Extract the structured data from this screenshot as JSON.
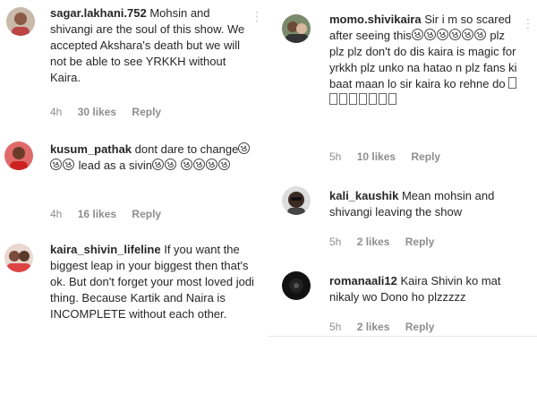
{
  "left_comments": [
    {
      "username": "sagar.lakhani.752",
      "text": "Mohsin and shivangi are the soul of this show. We accepted Akshara's death but we will not be able to see YRKKH without Kaira.",
      "time": "4h",
      "likes": "30 likes",
      "reply": "Reply"
    },
    {
      "username": "kusum_pathak",
      "text_a": "dont dare to change",
      "text_b": "lead as a sivin",
      "time": "4h",
      "likes": "16 likes",
      "reply": "Reply"
    },
    {
      "username": "kaira_shivin_lifeline",
      "text": "If you want the biggest leap in your biggest then that's ok. But don't forget your most loved jodi thing. Because Kartik and Naira is INCOMPLETE without each other."
    }
  ],
  "right_comments": [
    {
      "username": "momo.shivikaira",
      "text_a": "Sir i m so scared after seeing this",
      "text_b": "plz plz plz don't do dis kaira is magic for yrkkh plz unko na hatao n plz fans ki baat maan lo sir kaira ko rehne do",
      "time": "5h",
      "likes": "10 likes",
      "reply": "Reply"
    },
    {
      "username": "kali_kaushik",
      "text": "Mean mohsin and shivangi leaving the show",
      "time": "5h",
      "likes": "2 likes",
      "reply": "Reply"
    },
    {
      "username": "romanaali12",
      "text": "Kaira Shivin ko mat nikaly wo Dono ho plzzzzz",
      "time": "5h",
      "likes": "2 likes",
      "reply": "Reply"
    }
  ],
  "icons": [
    "more-options-icon",
    "emoji-icon"
  ],
  "colors": {
    "text": "#262626",
    "meta": "#8e8e8e",
    "divider": "#e6e6e6"
  }
}
